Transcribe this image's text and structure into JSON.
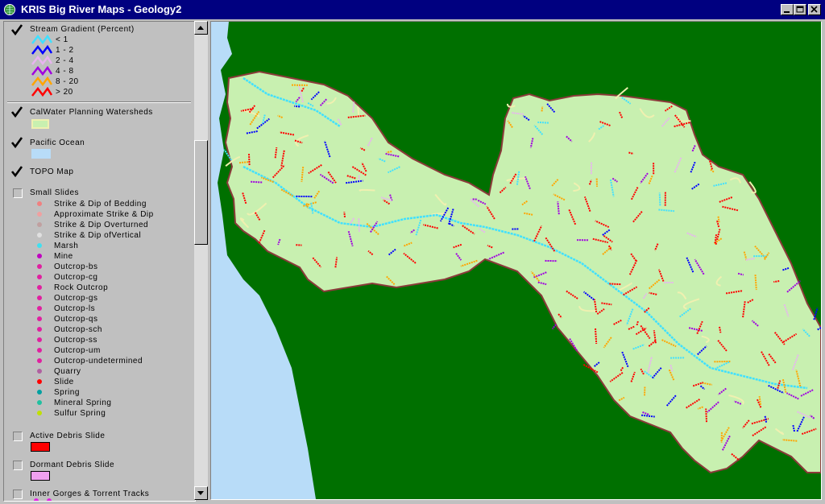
{
  "window": {
    "title": "KRIS Big River Maps - Geology2"
  },
  "legend": {
    "stream_gradient": {
      "label": "Stream Gradient (Percent)",
      "checked": true,
      "classes": [
        {
          "label": "< 1",
          "color": "#40e0ff"
        },
        {
          "label": "1 - 2",
          "color": "#0000ff"
        },
        {
          "label": "2 - 4",
          "color": "#e8b4f0"
        },
        {
          "label": "4 - 8",
          "color": "#a000e0"
        },
        {
          "label": "8 - 20",
          "color": "#ffa500"
        },
        {
          "label": "> 20",
          "color": "#ff0000"
        }
      ]
    },
    "calwater": {
      "label": "CalWater Planning Watersheds",
      "checked": true,
      "color": "#f0f0b0"
    },
    "pacific_ocean": {
      "label": "Pacific Ocean",
      "checked": true,
      "color": "#b8dcf8"
    },
    "topo": {
      "label": "TOPO Map",
      "checked": true
    },
    "small_slides": {
      "label": "Small Slides",
      "checked": false,
      "items": [
        {
          "label": "Strike & Dip of Bedding",
          "color": "#f08080"
        },
        {
          "label": "Approximate Strike & Dip",
          "color": "#f0a0a0"
        },
        {
          "label": "Strike & Dip Overturned",
          "color": "#c0a0a0"
        },
        {
          "label": "Strike & Dip ofVertical",
          "color": "#e0e0e0"
        },
        {
          "label": "Marsh",
          "color": "#40e0f0"
        },
        {
          "label": "Mine",
          "color": "#c000c0"
        },
        {
          "label": "Outcrop-bs",
          "color": "#e020a0"
        },
        {
          "label": "Outcrop-cg",
          "color": "#e020a0"
        },
        {
          "label": "Rock Outcrop",
          "color": "#e020a0"
        },
        {
          "label": "Outcrop-gs",
          "color": "#e020a0"
        },
        {
          "label": "Outcrop-ls",
          "color": "#e020a0"
        },
        {
          "label": "Outcrop-qs",
          "color": "#e020a0"
        },
        {
          "label": "Outcrop-sch",
          "color": "#e020a0"
        },
        {
          "label": "Outcrop-ss",
          "color": "#e020a0"
        },
        {
          "label": "Outcrop-um",
          "color": "#e020a0"
        },
        {
          "label": "Outcrop-undetermined",
          "color": "#e020a0"
        },
        {
          "label": "Quarry",
          "color": "#b060a0"
        },
        {
          "label": "Slide",
          "color": "#ff0000"
        },
        {
          "label": "Spring",
          "color": "#00a0a0"
        },
        {
          "label": "Mineral Spring",
          "color": "#20c0a0"
        },
        {
          "label": "Sulfur Spring",
          "color": "#c0e000"
        }
      ]
    },
    "active_debris": {
      "label": "Active Debris Slide",
      "checked": false,
      "color": "#ff0000"
    },
    "dormant_debris": {
      "label": "Dormant Debris Slide",
      "checked": false,
      "color": "#f0a0f0"
    },
    "inner_gorges": {
      "label": "Inner Gorges & Torrent Tracks",
      "checked": false,
      "color": "#e020e0"
    }
  },
  "map": {
    "background_color": "#007000",
    "ocean_color": "#b8dcf8",
    "watershed_color": "#c8f0b0",
    "boundary_color": "#8b3a3a"
  }
}
